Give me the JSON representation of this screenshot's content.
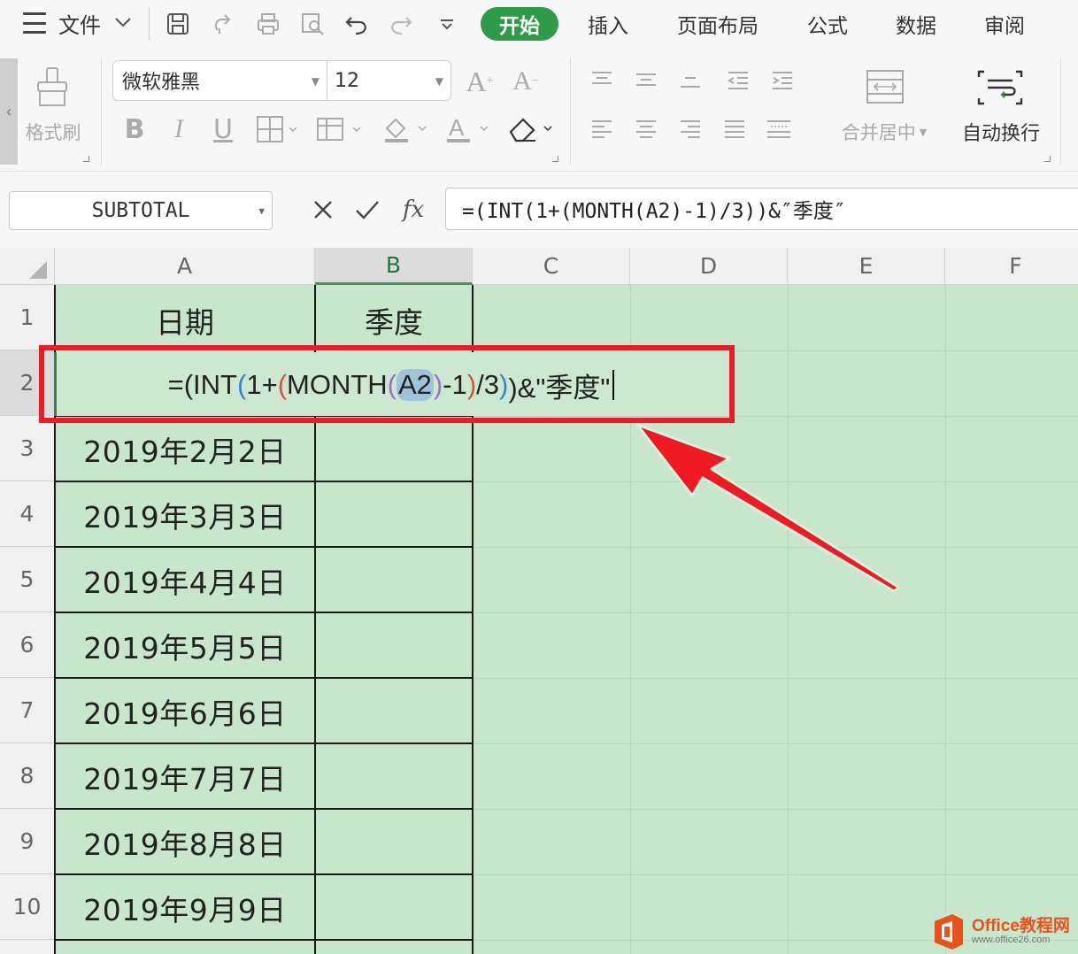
{
  "menu": {
    "file_label": "文件",
    "tabs": [
      {
        "label": "开始",
        "active": true
      },
      {
        "label": "插入",
        "active": false
      },
      {
        "label": "页面布局",
        "active": false
      },
      {
        "label": "公式",
        "active": false
      },
      {
        "label": "数据",
        "active": false
      },
      {
        "label": "审阅",
        "active": false
      }
    ]
  },
  "ribbon": {
    "format_painter_label": "格式刷",
    "font_name": "微软雅黑",
    "font_size": "12",
    "merge_center_label": "合并居中",
    "wrap_text_label": "自动换行"
  },
  "formula_bar": {
    "name_box": "SUBTOTAL",
    "formula": "=(INT(1+(MONTH(A2)-1)/3))&″季度″"
  },
  "grid": {
    "columns": [
      "A",
      "B",
      "C",
      "D",
      "E",
      "F"
    ],
    "selected_column": "B",
    "rows": [
      "1",
      "2",
      "3",
      "4",
      "5",
      "6",
      "7",
      "8",
      "9",
      "10"
    ],
    "header_row": {
      "a": "日期",
      "b": "季度"
    },
    "dates": [
      "2019年2月2日",
      "2019年3月3日",
      "2019年4月4日",
      "2019年5月5日",
      "2019年6月6日",
      "2019年7月7日",
      "2019年8月8日",
      "2019年9月9日"
    ],
    "edit_formula": {
      "p1": "=(INT",
      "p2": "(",
      "p3": "1+",
      "p4": "(",
      "p5": "MONTH",
      "p6": "(",
      "ref": "A2",
      "p7": ")",
      "p8": "-1",
      "p9": ")",
      "p10": "/3",
      "p11": ")",
      "p12": ")&\"季度\""
    }
  },
  "watermark": {
    "title": "Office教程网",
    "url": "www.office26.com"
  },
  "colors": {
    "active_tab": "#2e9a4a",
    "grid_fill": "#c8e6cc",
    "highlight_border": "#ee1b24"
  }
}
